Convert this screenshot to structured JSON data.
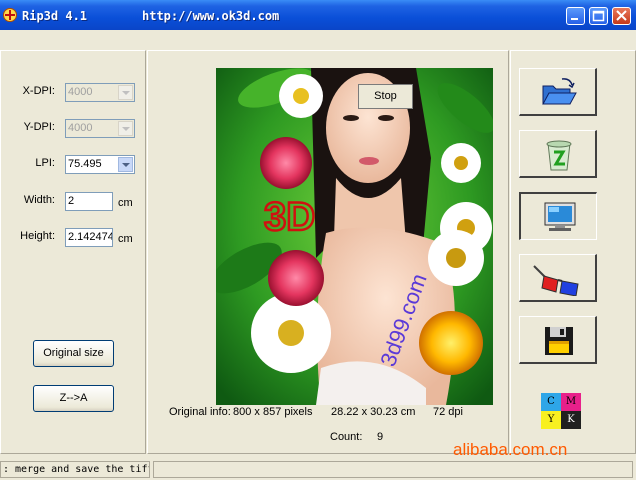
{
  "window": {
    "title": "Rip3d 4.1",
    "url": "http://www.ok3d.com"
  },
  "left": {
    "xdpi_label": "X-DPI:",
    "xdpi_value": "4000",
    "ydpi_label": "Y-DPI:",
    "ydpi_value": "4000",
    "lpi_label": "LPI:",
    "lpi_value": "75.495",
    "width_label": "Width:",
    "width_value": "2",
    "width_unit": "cm",
    "height_label": "Height:",
    "height_value": "2.142474",
    "height_unit": "cm",
    "original_size_label": "Original size",
    "z_a_label": "Z-->A"
  },
  "center": {
    "stop_label": "Stop",
    "image_text_3d": "3D",
    "image_watermark": "3d99.com",
    "info_label": "Original info:",
    "info_pixels": "800 x 857  pixels",
    "info_cm": "28.22 x 30.23  cm",
    "info_dpi": "72 dpi",
    "count_label": "Count:",
    "count_value": "9"
  },
  "toolbar": {
    "open_icon": "open-folder-icon",
    "recycle_icon": "recycle-bin-icon",
    "monitor_icon": "monitor-icon",
    "glasses_icon": "3d-glasses-icon",
    "save_icon": "floppy-disk-icon"
  },
  "cmyk": {
    "c": "C",
    "m": "M",
    "y": "Y",
    "k": "K"
  },
  "status": {
    "text": ": merge and save the tiff"
  },
  "watermark": "alibaba.com.cn"
}
